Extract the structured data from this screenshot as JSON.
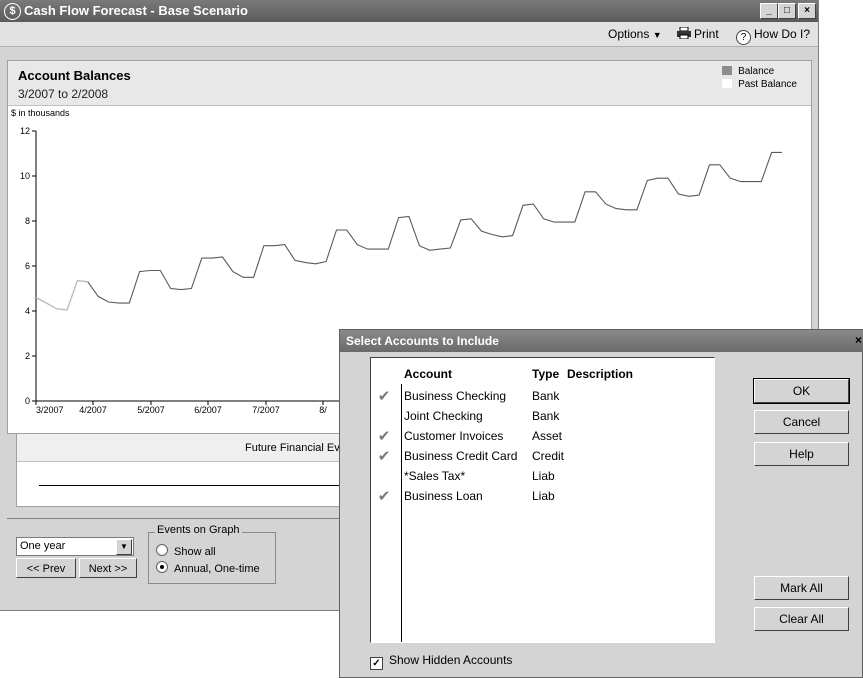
{
  "window": {
    "title": "Cash Flow Forecast - Base Scenario",
    "min_glyph": "_",
    "max_glyph": "□",
    "close_glyph": "×",
    "app_icon_glyph": "$"
  },
  "toolbar": {
    "options_label": "Options",
    "print_label": "Print",
    "help_label": "How Do I?"
  },
  "chart_header": {
    "title": "Account Balances",
    "subtitle": "3/2007 to 2/2008",
    "units": "$ in thousands"
  },
  "legend": [
    {
      "label": "Balance",
      "color": "#8c8c8c"
    },
    {
      "label": "Past Balance",
      "color": "#ffffff"
    }
  ],
  "chart_data": {
    "type": "line",
    "ylim": [
      0,
      12
    ],
    "y_ticks": [
      "0",
      "2",
      "4",
      "6",
      "8",
      "10",
      "12"
    ],
    "x_tick_labels": [
      "3/2007",
      "4/2007",
      "5/2007",
      "6/2007",
      "7/2007",
      "8/"
    ],
    "series": [
      {
        "name": "Past Balance",
        "values": [
          4.6,
          4.35,
          4.1,
          4.05,
          5.35,
          5.3
        ]
      },
      {
        "name": "Balance",
        "values": [
          5.3,
          4.65,
          4.4,
          4.35,
          4.35,
          5.75,
          5.8,
          5.8,
          5.0,
          4.95,
          5.0,
          6.35,
          6.35,
          6.4,
          5.75,
          5.5,
          5.5,
          6.9,
          6.9,
          6.95,
          6.25,
          6.15,
          6.1,
          6.2,
          7.6,
          7.6,
          6.95,
          6.75,
          6.75,
          6.75,
          8.15,
          8.2,
          6.9,
          6.7,
          6.75,
          6.8,
          8.05,
          8.1,
          7.55,
          7.4,
          7.3,
          7.35,
          8.7,
          8.75,
          8.1,
          7.95,
          7.95,
          7.95,
          9.3,
          9.3,
          8.75,
          8.55,
          8.5,
          8.5,
          9.8,
          9.9,
          9.9,
          9.2,
          9.1,
          9.15,
          10.5,
          10.5,
          9.9,
          9.75,
          9.75,
          9.75,
          11.05,
          11.05
        ]
      }
    ]
  },
  "events": {
    "title": "Future Financial Ev"
  },
  "controls": {
    "period_value": "One year",
    "prev_label": "<< Prev",
    "next_label": "Next >>",
    "group_label": "Events on Graph",
    "radio_show_all": "Show all",
    "radio_annual": "Annual, One-time"
  },
  "dialog": {
    "title": "Select Accounts to Include",
    "close_glyph": "×",
    "col_account": "Account",
    "col_type": "Type",
    "col_description": "Description",
    "accounts": [
      {
        "name": "Business Checking",
        "type": "Bank",
        "checked": true
      },
      {
        "name": "Joint Checking",
        "type": "Bank",
        "checked": false
      },
      {
        "name": "Customer Invoices",
        "type": "Asset",
        "checked": true
      },
      {
        "name": "Business Credit Card",
        "type": "Credit",
        "checked": true
      },
      {
        "name": "*Sales Tax*",
        "type": "Liab",
        "checked": false
      },
      {
        "name": "Business Loan",
        "type": "Liab",
        "checked": true
      }
    ],
    "ok_label": "OK",
    "cancel_label": "Cancel",
    "help_label": "Help",
    "mark_all_label": "Mark All",
    "clear_all_label": "Clear All",
    "show_hidden_label": "Show Hidden Accounts",
    "show_hidden_checked": true
  }
}
